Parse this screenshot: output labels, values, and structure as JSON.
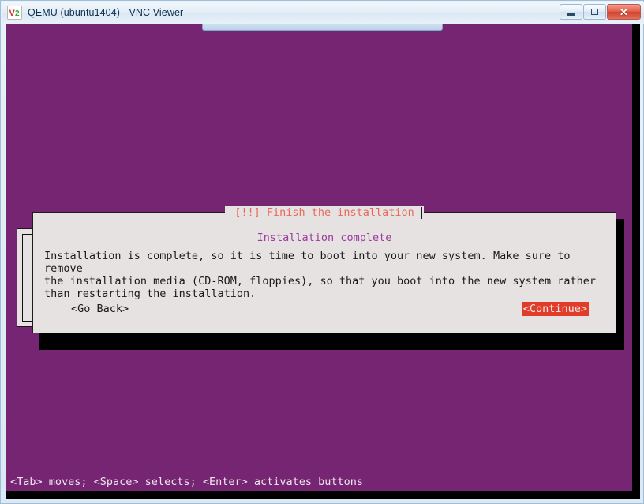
{
  "window": {
    "title": "QEMU (ubuntu1404) - VNC Viewer",
    "logo_icon": "vnc-logo-icon",
    "controls": {
      "minimize_label": "–",
      "restore_label": "□",
      "close_label": "✕"
    }
  },
  "colors": {
    "installer_background": "#762572",
    "dialog_background": "#e6e2e2",
    "dialog_title": "#e8695c",
    "heading": "#9c3b9c",
    "focused_button_background": "#e03c28",
    "focused_button_text": "#f2e9e9",
    "frame": "#9ebfd9"
  },
  "dialog": {
    "title": "[!!] Finish the installation",
    "heading": "Installation complete",
    "body": "Installation is complete, so it is time to boot into your new system. Make sure to remove\nthe installation media (CD-ROM, floppies), so that you boot into the new system rather\nthan restarting the installation.",
    "buttons": [
      {
        "label": "<Go Back>",
        "focused": false
      },
      {
        "label": "<Continue>",
        "focused": true
      }
    ]
  },
  "status": {
    "help_line": "<Tab> moves; <Space> selects; <Enter> activates buttons"
  }
}
